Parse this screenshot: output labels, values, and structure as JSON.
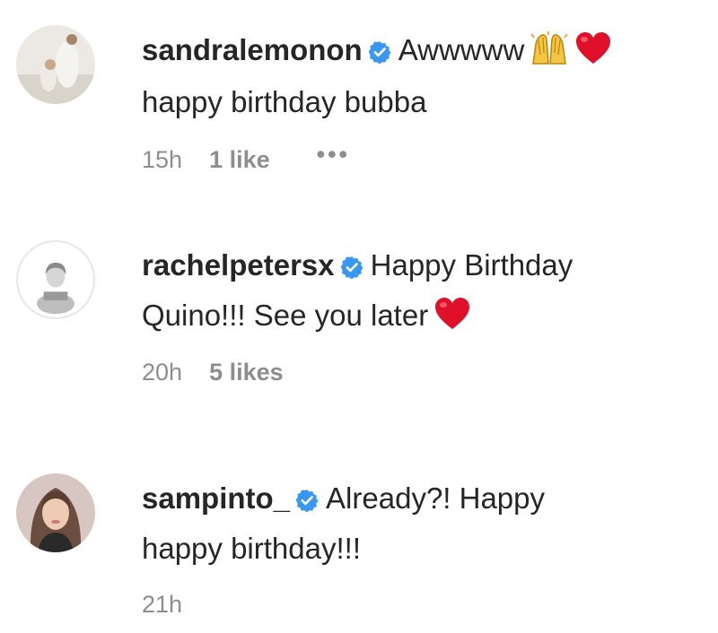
{
  "comments": [
    {
      "username": "sandralemonon",
      "verified": true,
      "text_line1": "Awwwww",
      "text_line2": "happy birthday bubba",
      "emojis": [
        "raising-hands-icon",
        "heart-icon"
      ],
      "time": "15h",
      "likes": "1 like",
      "more": "•••"
    },
    {
      "username": "rachelpetersx",
      "verified": true,
      "text_line1": "Happy Birthday",
      "text_line2": "Quino!!! See you later",
      "emojis": [
        "heart-icon"
      ],
      "time": "20h",
      "likes": "5 likes"
    },
    {
      "username": "sampinto_",
      "verified": true,
      "text_line1": "Already?! Happy",
      "text_line2": "happy birthday!!!",
      "time": "21h"
    }
  ],
  "colors": {
    "text": "#262626",
    "meta": "#8e8e8e",
    "verified": "#3897f0",
    "heart": "#e0102a"
  }
}
